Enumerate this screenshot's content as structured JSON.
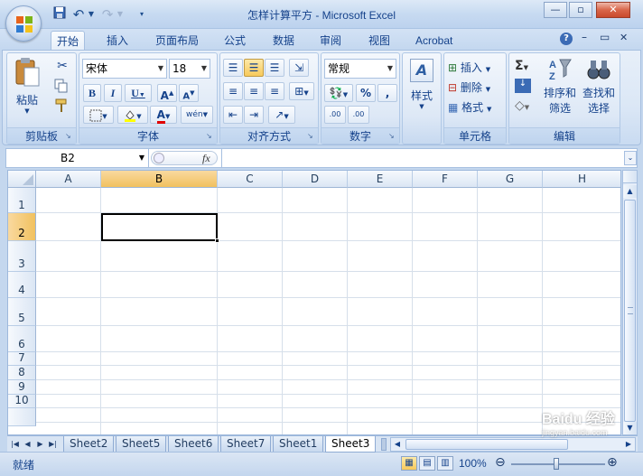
{
  "window": {
    "title": "怎样计算平方 - Microsoft Excel",
    "min": "—",
    "restore": "▫",
    "close": "✕"
  },
  "quick_access": {
    "save_icon": "save-icon",
    "undo": "↶",
    "redo": "↷"
  },
  "tabs": [
    "开始",
    "插入",
    "页面布局",
    "公式",
    "数据",
    "审阅",
    "视图",
    "Acrobat"
  ],
  "active_tab": 0,
  "ribbon_right": {
    "help": "?",
    "min": "–",
    "restore": "▭",
    "close": "✕"
  },
  "groups": {
    "clipboard": {
      "label": "剪贴板",
      "paste": "粘贴"
    },
    "font": {
      "label": "字体",
      "font_name": "宋体",
      "font_size": "18",
      "bold": "B",
      "italic": "I",
      "underline": "U",
      "grow": "A",
      "shrink": "A",
      "font_color": "A",
      "phonetic": "wén"
    },
    "alignment": {
      "label": "对齐方式"
    },
    "number": {
      "label": "数字",
      "format": "常规",
      "percent": "%",
      "comma": ",",
      "inc": ".00",
      "dec": ".00"
    },
    "styles": {
      "label": "样式"
    },
    "cells": {
      "label": "单元格",
      "insert": "插入",
      "delete": "删除",
      "format": "格式"
    },
    "editing": {
      "label": "编辑",
      "sigma": "Σ",
      "sort": "排序和",
      "sort2": "筛选",
      "find": "查找和",
      "find2": "选择"
    }
  },
  "formula_bar": {
    "name_box": "B2",
    "fx": "fx",
    "formula": ""
  },
  "columns": [
    "A",
    "B",
    "C",
    "D",
    "E",
    "F",
    "G",
    "H"
  ],
  "selected_column": "B",
  "rows": [
    "1",
    "2",
    "3",
    "4",
    "5",
    "6",
    "7",
    "8",
    "9",
    "10"
  ],
  "selected_row": "2",
  "sheets": [
    "Sheet2",
    "Sheet5",
    "Sheet6",
    "Sheet7",
    "Sheet1",
    "Sheet3"
  ],
  "active_sheet": "Sheet3",
  "status": {
    "ready": "就绪",
    "zoom": "100%",
    "minus": "⊖",
    "plus": "⊕"
  },
  "watermark": {
    "line1": "Baidu 经验",
    "line2": "jingyan.baidu.com"
  },
  "colors": {
    "selection_header": "#f1c15f",
    "ribbon": "#dbe7f6",
    "accent": "#15428b"
  }
}
